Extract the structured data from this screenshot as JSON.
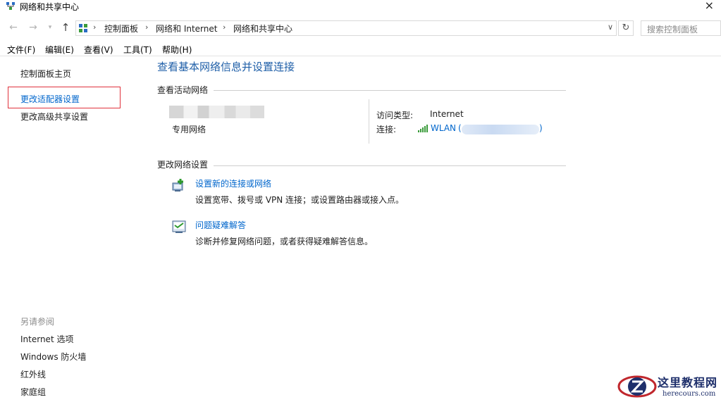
{
  "window": {
    "title": "网络和共享中心",
    "close_glyph": "×"
  },
  "address": {
    "crumbs": [
      "控制面板",
      "网络和 Internet",
      "网络和共享中心"
    ],
    "search_placeholder": "搜索控制面板"
  },
  "menu": [
    "文件(F)",
    "编辑(E)",
    "查看(V)",
    "工具(T)",
    "帮助(H)"
  ],
  "sidebar": {
    "items": [
      "控制面板主页",
      "更改适配器设置",
      "更改高级共享设置"
    ],
    "see_also_title": "另请参阅",
    "see_also": [
      "Internet 选项",
      "Windows 防火墙",
      "红外线",
      "家庭组"
    ]
  },
  "main": {
    "title": "查看基本网络信息并设置连接",
    "active_networks_header": "查看活动网络",
    "network": {
      "type": "专用网络",
      "access_label": "访问类型:",
      "access_value": "Internet",
      "connection_label": "连接:",
      "connection_value": "WLAN",
      "paren_open": "(",
      "paren_close": ")"
    },
    "change_settings_header": "更改网络设置",
    "tasks": [
      {
        "icon": "new-connection-icon",
        "link": "设置新的连接或网络",
        "desc": "设置宽带、拨号或 VPN 连接；或设置路由器或接入点。"
      },
      {
        "icon": "troubleshoot-icon",
        "link": "问题疑难解答",
        "desc": "诊断并修复网络问题，或者获得疑难解答信息。"
      }
    ]
  },
  "watermark": {
    "text": "这里教程网",
    "url": "herecours.com"
  },
  "colors": {
    "link": "#0066cc",
    "title": "#1f5fa8",
    "highlight_border": "#e0323c"
  }
}
